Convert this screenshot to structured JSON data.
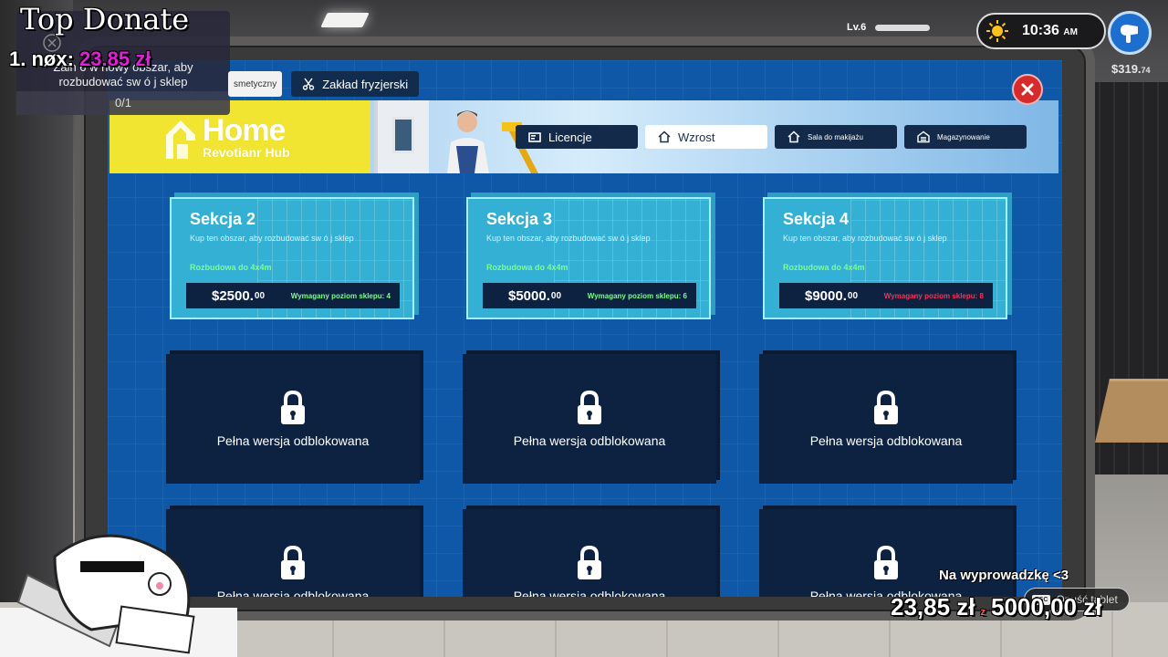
{
  "hud": {
    "level": "Lv.6",
    "time": "10:36",
    "ampm": "AM",
    "money": "$319.",
    "money_cents": "74"
  },
  "top_tabs": [
    {
      "label": "smetyczny",
      "icon": "none"
    },
    {
      "label": "Zakład fryzjerski",
      "icon": "scissors-icon"
    }
  ],
  "banner": {
    "brand_home": "Home",
    "brand_sub": "Revotianr Hub"
  },
  "category_tabs": [
    {
      "label": "Licencje",
      "icon": "license-icon",
      "active": false
    },
    {
      "label": "Wzrost",
      "icon": "home-icon",
      "active": true
    },
    {
      "label": "Sala do makijażu",
      "icon": "home-icon",
      "active": false
    },
    {
      "label": "Magazynowanie",
      "icon": "warehouse-icon",
      "active": false
    }
  ],
  "sections": [
    {
      "title": "Sekcja 2",
      "desc": "Kup ten obszar, aby rozbudować sw ó j sklep",
      "expand": "Rozbudowa do 4x4m",
      "price": "$2500.",
      "cents": "00",
      "req": "Wymagany poziom sklepu: 4",
      "req_met": true
    },
    {
      "title": "Sekcja 3",
      "desc": "Kup ten obszar, aby rozbudować sw ó j sklep",
      "expand": "Rozbudowa do 4x4m",
      "price": "$5000.",
      "cents": "00",
      "req": "Wymagany poziom sklepu: 6",
      "req_met": true
    },
    {
      "title": "Sekcja 4",
      "desc": "Kup ten obszar, aby rozbudować sw ó j sklep",
      "expand": "Rozbudowa do 4x4m",
      "price": "$9000.",
      "cents": "00",
      "req": "Wymagany poziom sklepu: 8",
      "req_met": false
    }
  ],
  "locked_label": "Pełna wersja odblokowana",
  "mission": {
    "text_line1": "Zain 6 w nowy obszar, aby",
    "text_line2": "rozbudować sw ó j sklep",
    "progress": "0/1"
  },
  "stream": {
    "donate_title": "Top Donate",
    "donor_name": "1. nøx:",
    "donor_amount": "23.85 zł",
    "goal_label": "Na wyprowadzkę <3",
    "goal_current": "23,85 zł",
    "goal_sep": "z",
    "goal_target": "5000,00 zł",
    "esc_key": "ESC",
    "esc_label": "Opuść tablet"
  },
  "colors": {
    "screen_bg": "#0f58a8",
    "card_bg": "#33b0d3",
    "locked_bg": "#0d2240",
    "brand_yellow": "#f2e531",
    "req_ok": "#7cff8a",
    "req_bad": "#ff2d55",
    "close_red": "#d62b2b",
    "donate_magenta": "#e21fd8"
  }
}
